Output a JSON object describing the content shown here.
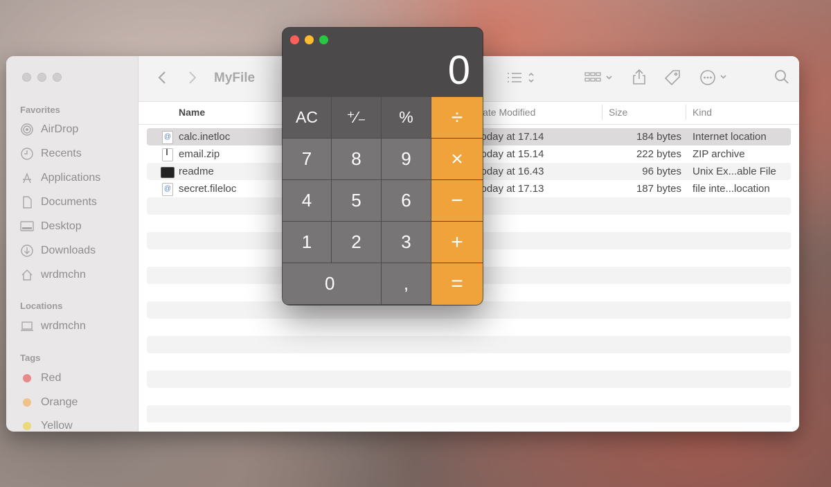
{
  "finder": {
    "title": "MyFile",
    "sidebar": {
      "favorites_label": "Favorites",
      "favorites": [
        {
          "label": "AirDrop",
          "icon": "airdrop-icon"
        },
        {
          "label": "Recents",
          "icon": "clock-icon"
        },
        {
          "label": "Applications",
          "icon": "applications-icon"
        },
        {
          "label": "Documents",
          "icon": "document-icon"
        },
        {
          "label": "Desktop",
          "icon": "desktop-icon"
        },
        {
          "label": "Downloads",
          "icon": "download-icon"
        },
        {
          "label": "wrdmchn",
          "icon": "home-icon"
        }
      ],
      "locations_label": "Locations",
      "locations": [
        {
          "label": "wrdmchn",
          "icon": "laptop-icon"
        }
      ],
      "tags_label": "Tags",
      "tags": [
        {
          "label": "Red",
          "color": "#e88a8a"
        },
        {
          "label": "Orange",
          "color": "#eec28a"
        },
        {
          "label": "Yellow",
          "color": "#ecd97a"
        }
      ]
    },
    "columns": {
      "name": "Name",
      "modified": "Date Modified",
      "size": "Size",
      "kind": "Kind"
    },
    "files": [
      {
        "name": "calc.inetloc",
        "modified": "Today at 17.14",
        "size": "184 bytes",
        "kind": "Internet location",
        "icon": "inetloc-icon"
      },
      {
        "name": "email.zip",
        "modified": "Today at 15.14",
        "size": "222 bytes",
        "kind": "ZIP archive",
        "icon": "zip-icon"
      },
      {
        "name": "readme",
        "modified": "Today at 16.43",
        "size": "96 bytes",
        "kind": "Unix Ex...able File",
        "icon": "terminal-icon"
      },
      {
        "name": "secret.fileloc",
        "modified": "Today at 17.13",
        "size": "187 bytes",
        "kind": "file inte...location",
        "icon": "fileloc-icon"
      }
    ]
  },
  "calculator": {
    "display": "0",
    "keys": {
      "ac": "AC",
      "sign": "⁺∕₋",
      "percent": "%",
      "divide": "÷",
      "seven": "7",
      "eight": "8",
      "nine": "9",
      "multiply": "×",
      "four": "4",
      "five": "5",
      "six": "6",
      "minus": "−",
      "one": "1",
      "two": "2",
      "three": "3",
      "plus": "+",
      "zero": "0",
      "decimal": ",",
      "equals": "="
    },
    "colors": {
      "operator": "#f1a33b",
      "digit": "#777575",
      "function": "#5d5b5b"
    }
  }
}
